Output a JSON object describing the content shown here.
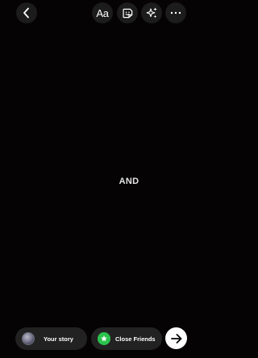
{
  "top_bar": {
    "back_icon": "chevron-left-icon",
    "text_tool_label": "Aa",
    "sticker_icon": "sticker-icon",
    "effects_icon": "sparkles-icon",
    "more_icon": "more-horizontal-icon"
  },
  "canvas": {
    "background_color": "#050303",
    "overlay_text": "AND"
  },
  "bottom_bar": {
    "your_story_label": "Your story",
    "close_friends_label": "Close Friends",
    "close_friends_color": "#2bc24d",
    "send_icon": "arrow-right-icon"
  }
}
